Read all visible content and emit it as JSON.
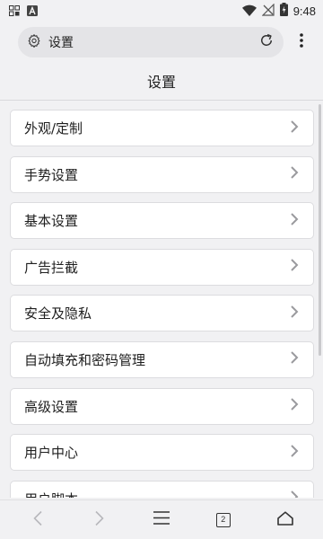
{
  "status_bar": {
    "time": "9:48",
    "left_icons": [
      "notification-grid-icon",
      "letter-a-icon"
    ],
    "right_icons": [
      "wifi-icon",
      "signal-off-icon",
      "battery-charging-icon"
    ]
  },
  "address_bar": {
    "text": "设置"
  },
  "page": {
    "title": "设置"
  },
  "settings": {
    "items": [
      {
        "label": "外观/定制"
      },
      {
        "label": "手势设置"
      },
      {
        "label": "基本设置"
      },
      {
        "label": "广告拦截"
      },
      {
        "label": "安全及隐私"
      },
      {
        "label": "自动填充和密码管理"
      },
      {
        "label": "高级设置"
      },
      {
        "label": "用户中心"
      },
      {
        "label": "用户脚本"
      }
    ]
  },
  "bottom_nav": {
    "tab_count": "2"
  },
  "colors": {
    "background": "#f1f1f3",
    "card": "#ffffff",
    "chevron": "#9a9a9e"
  }
}
